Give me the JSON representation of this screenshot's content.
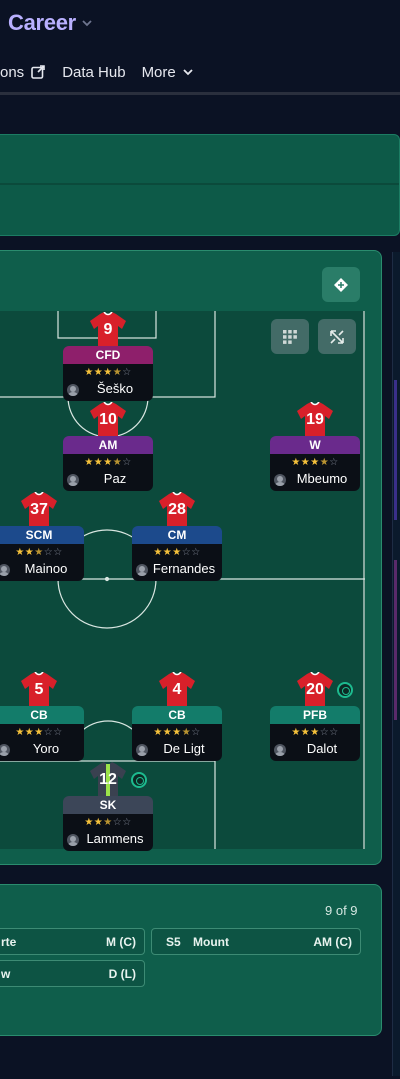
{
  "header": {
    "title": "Career",
    "nav": {
      "item1": "ons",
      "item2": "Data Hub",
      "item3": "More"
    }
  },
  "players": [
    {
      "id": "cfd",
      "number": "9",
      "position": "CFD",
      "stars": 3.5,
      "name": "Šeško",
      "pos_color": "#8e1f6b"
    },
    {
      "id": "am",
      "number": "10",
      "position": "AM",
      "stars": 3.5,
      "name": "Paz",
      "pos_color": "#6a2a8c"
    },
    {
      "id": "w",
      "number": "19",
      "position": "W",
      "stars": 3.5,
      "name": "Mbeumo",
      "pos_color": "#6a2a8c"
    },
    {
      "id": "scm",
      "number": "37",
      "position": "SCM",
      "stars": 2.5,
      "name": "Mainoo",
      "pos_color": "#1c4a8c"
    },
    {
      "id": "cm",
      "number": "28",
      "position": "CM",
      "stars": 3,
      "name": "Fernandes",
      "pos_color": "#1c4a8c"
    },
    {
      "id": "cb1",
      "number": "5",
      "position": "CB",
      "stars": 3,
      "name": "Yoro",
      "pos_color": "#137c6a"
    },
    {
      "id": "cb2",
      "number": "4",
      "position": "CB",
      "stars": 3.5,
      "name": "De Ligt",
      "pos_color": "#137c6a"
    },
    {
      "id": "pfb",
      "number": "20",
      "position": "PFB",
      "stars": 3,
      "name": "Dalot",
      "pos_color": "#137c6a"
    },
    {
      "id": "sk",
      "number": "12",
      "position": "SK",
      "stars": 2.5,
      "name": "Lammens",
      "pos_color": "#3c4658"
    }
  ],
  "bench": {
    "count": "9 of 9",
    "rows": [
      {
        "left": "rte",
        "right": "M (C)"
      },
      {
        "slot": "S5",
        "name": "Mount",
        "right": "AM (C)"
      },
      {
        "left": "w",
        "right": "D (L)"
      }
    ]
  },
  "icons": {
    "swap": "swap-icon",
    "grid": "grid-icon",
    "expand": "expand-icon"
  },
  "colors": {
    "accent": "#b9b0ff",
    "pitch": "#0c4a3c",
    "card": "#0f5e4b",
    "shirt": "#d8202a",
    "star": "#f5c13b"
  }
}
